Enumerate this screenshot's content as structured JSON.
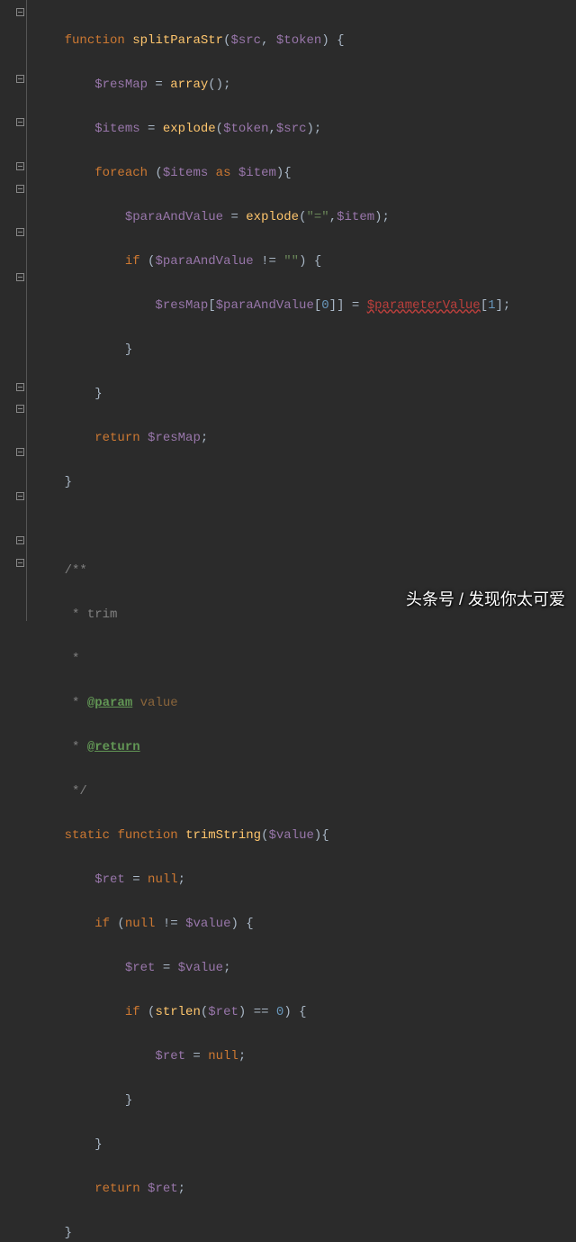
{
  "code": {
    "fn1": {
      "sig_kw": "function",
      "sig_name": "splitParaStr",
      "sig_p1": "$src",
      "sig_p2": "$token",
      "l2_var": "$resMap",
      "l2_fn": "array",
      "l3_var": "$items",
      "l3_fn": "explode",
      "l3_a1": "$token",
      "l3_a2": "$src",
      "l4_kw": "foreach",
      "l4_a": "$items",
      "l4_as": "as",
      "l4_b": "$item",
      "l5_var": "$paraAndValue",
      "l5_fn": "explode",
      "l5_str": "\"=\"",
      "l5_a2": "$item",
      "l6_kw": "if",
      "l6_var": "$paraAndValue",
      "l6_str": "\"\"",
      "l7_a": "$resMap",
      "l7_b": "$paraAndValue",
      "l7_n1": "0",
      "l7_err": "$parameterValue",
      "l7_n2": "1",
      "ret_kw": "return",
      "ret_var": "$resMap"
    },
    "doc": {
      "open": "/**",
      "l1": " * trim",
      "l2": " *",
      "l3_pre": " * ",
      "l3_tag": "@param",
      "l3_name": " value",
      "l4_pre": " * ",
      "l4_tag": "@return",
      "close": " */"
    },
    "fn2": {
      "mod": "static",
      "kw": "function",
      "name": "trimString",
      "p1": "$value",
      "l2_var": "$ret",
      "l2_kw": "null",
      "l3_kw": "if",
      "l3_null": "null",
      "l3_var": "$value",
      "l4_a": "$ret",
      "l4_b": "$value",
      "l5_kw": "if",
      "l5_fn": "strlen",
      "l5_var": "$ret",
      "l5_n": "0",
      "l6_a": "$ret",
      "l6_null": "null",
      "ret_kw": "return",
      "ret_var": "$ret"
    }
  },
  "watermark": "头条号 / 发现你太可爱"
}
